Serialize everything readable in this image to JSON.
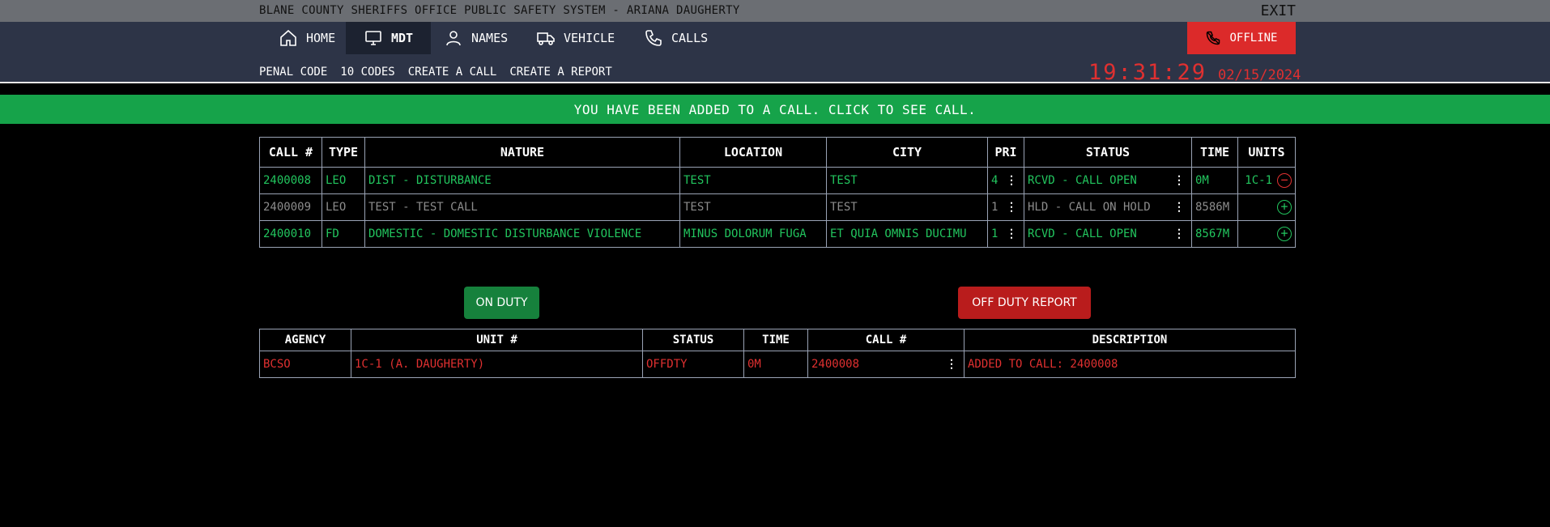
{
  "header": {
    "title": "BLANE COUNTY SHERIFFS OFFICE PUBLIC SAFETY SYSTEM - ARIANA DAUGHERTY",
    "exit_label": "EXIT"
  },
  "nav": {
    "tabs": [
      {
        "label": "HOME",
        "icon": "home-icon"
      },
      {
        "label": "MDT",
        "icon": "monitor-icon",
        "active": true
      },
      {
        "label": "NAMES",
        "icon": "person-icon"
      },
      {
        "label": "VEHICLE",
        "icon": "truck-icon"
      },
      {
        "label": "CALLS",
        "icon": "phone-icon"
      }
    ],
    "offline_label": "OFFLINE",
    "sublinks": [
      "PENAL CODE",
      "10 CODES",
      "CREATE A CALL",
      "CREATE A REPORT"
    ],
    "clock_time": "19:31:29",
    "clock_date": "02/15/2024"
  },
  "banner": "YOU HAVE BEEN ADDED TO A CALL. CLICK TO SEE CALL.",
  "calls": {
    "headers": [
      "CALL #",
      "TYPE",
      "NATURE",
      "LOCATION",
      "CITY",
      "PRI",
      "STATUS",
      "TIME",
      "UNITS"
    ],
    "rows": [
      {
        "call": "2400008",
        "type": "LEO",
        "nature": "DIST - DISTURBANCE",
        "location": "TEST",
        "city": "TEST",
        "pri": "4",
        "status": "RCVD - CALL OPEN",
        "time": "0M",
        "unit": "1C-1",
        "action": "minus"
      },
      {
        "call": "2400009",
        "type": "LEO",
        "nature": "TEST - TEST CALL",
        "location": "TEST",
        "city": "TEST",
        "pri": "1",
        "status": "HLD - CALL ON HOLD",
        "time": "8586M",
        "unit": "",
        "action": "plus"
      },
      {
        "call": "2400010",
        "type": "FD",
        "nature": "DOMESTIC - DOMESTIC DISTURBANCE VIOLENCE",
        "location": "MINUS DOLORUM FUGA",
        "city": "ET QUIA OMNIS DUCIMU",
        "pri": "1",
        "status": "RCVD - CALL OPEN",
        "time": "8567M",
        "unit": "",
        "action": "plus"
      }
    ]
  },
  "buttons": {
    "on_duty": "ON DUTY",
    "off_duty": "OFF DUTY REPORT"
  },
  "units": {
    "headers": [
      "AGENCY",
      "UNIT #",
      "STATUS",
      "TIME",
      "CALL #",
      "DESCRIPTION"
    ],
    "rows": [
      {
        "agency": "BCSO",
        "unit": "1C-1 (A. DAUGHERTY)",
        "status": "OFFDTY",
        "time": "0M",
        "call": "2400008",
        "description": "ADDED TO CALL: 2400008"
      }
    ]
  },
  "colors": {
    "accent_green": "#16a34a",
    "alert_red": "#dc2a2a",
    "nav_bg": "#2d3447"
  }
}
